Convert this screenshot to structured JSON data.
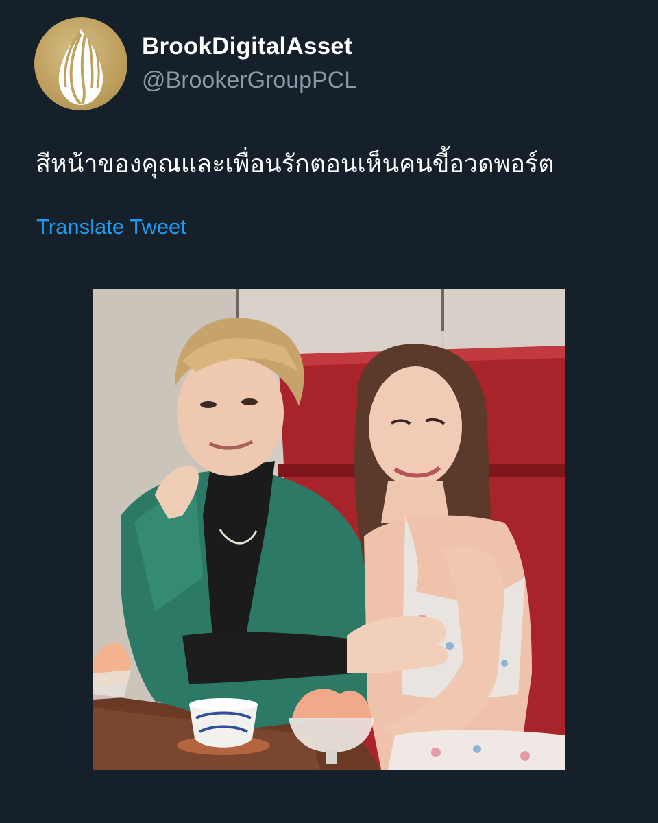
{
  "author": {
    "display_name": "BrookDigitalAsset",
    "handle": "@BrookerGroupPCL",
    "avatar_icon": "brooker-flame-logo-icon"
  },
  "tweet": {
    "text": "สีหน้าของคุณและเพื่อนรักตอนเห็นคนขี้อวดพอร์ต",
    "translate_label": "Translate Tweet"
  },
  "media": {
    "description_icon": "photo-two-people-at-dessert-table"
  },
  "colors": {
    "background": "#15202b",
    "primary_text": "#ffffff",
    "secondary_text": "#8b98a5",
    "link": "#1d9bf0",
    "avatar_gold": "#bfa160"
  }
}
